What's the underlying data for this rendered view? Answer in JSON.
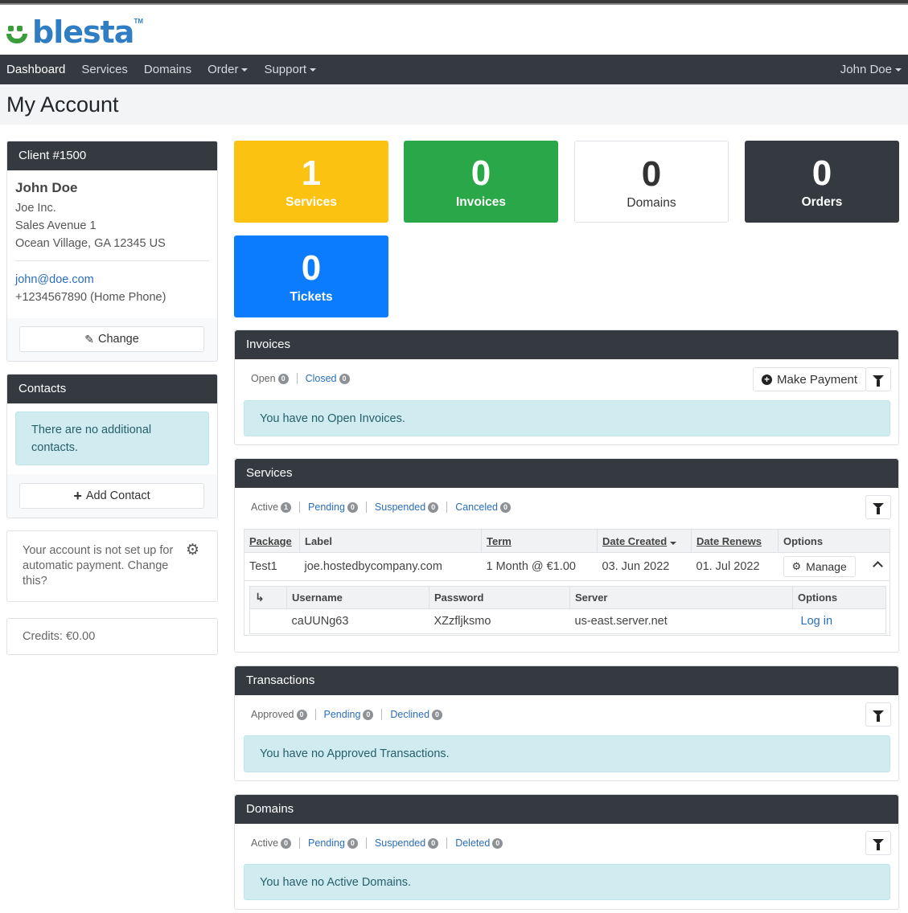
{
  "brand": {
    "name": "blesta",
    "tm": "TM"
  },
  "nav": {
    "items": [
      {
        "label": "Dashboard",
        "dropdown": false
      },
      {
        "label": "Services",
        "dropdown": false
      },
      {
        "label": "Domains",
        "dropdown": false
      },
      {
        "label": "Order",
        "dropdown": true
      },
      {
        "label": "Support",
        "dropdown": true
      }
    ],
    "user": "John Doe"
  },
  "page_title": "My Account",
  "client": {
    "header": "Client #1500",
    "name": "John Doe",
    "company": "Joe Inc.",
    "address1": "Sales Avenue 1",
    "address2": "Ocean Village, GA 12345 US",
    "email": "john@doe.com",
    "phone": "+1234567890 (Home Phone)",
    "change_label": "Change"
  },
  "contacts": {
    "header": "Contacts",
    "empty": "There are no additional contacts.",
    "add_label": "Add Contact"
  },
  "autopay": {
    "text": "Your account is not set up for automatic payment. Change this?"
  },
  "credits": {
    "text": "Credits: €0.00"
  },
  "stats": [
    {
      "value": "1",
      "label": "Services",
      "color": "#fbc212"
    },
    {
      "value": "0",
      "label": "Invoices",
      "color": "#2aa748"
    },
    {
      "value": "0",
      "label": "Domains",
      "color": "#ffffff"
    },
    {
      "value": "0",
      "label": "Orders",
      "color": "#353a40"
    },
    {
      "value": "0",
      "label": "Tickets",
      "color": "#0a7cfd"
    }
  ],
  "invoices": {
    "header": "Invoices",
    "filters": [
      {
        "label": "Open",
        "count": "0"
      },
      {
        "label": "Closed",
        "count": "0"
      }
    ],
    "make_payment": "Make Payment",
    "empty": "You have no Open Invoices."
  },
  "services": {
    "header": "Services",
    "filters": [
      {
        "label": "Active",
        "count": "1"
      },
      {
        "label": "Pending",
        "count": "0"
      },
      {
        "label": "Suspended",
        "count": "0"
      },
      {
        "label": "Canceled",
        "count": "0"
      }
    ],
    "columns": [
      "Package",
      "Label",
      "Term",
      "Date Created",
      "Date Renews",
      "Options"
    ],
    "row": {
      "package": "Test1",
      "label": "joe.hostedbycompany.com",
      "term": "1 Month @ €1.00",
      "created": "03. Jun 2022",
      "renews": "01. Jul 2022",
      "manage": "Manage"
    },
    "sub_columns": [
      "Username",
      "Password",
      "Server",
      "Options"
    ],
    "sub_row": {
      "username": "caUUNg63",
      "password": "XZzfljksmo",
      "server": "us-east.server.net",
      "login": "Log in"
    }
  },
  "transactions": {
    "header": "Transactions",
    "filters": [
      {
        "label": "Approved",
        "count": "0"
      },
      {
        "label": "Pending",
        "count": "0"
      },
      {
        "label": "Declined",
        "count": "0"
      }
    ],
    "empty": "You have no Approved Transactions."
  },
  "domains": {
    "header": "Domains",
    "filters": [
      {
        "label": "Active",
        "count": "0"
      },
      {
        "label": "Pending",
        "count": "0"
      },
      {
        "label": "Suspended",
        "count": "0"
      },
      {
        "label": "Deleted",
        "count": "0"
      }
    ],
    "empty": "You have no Active Domains."
  }
}
